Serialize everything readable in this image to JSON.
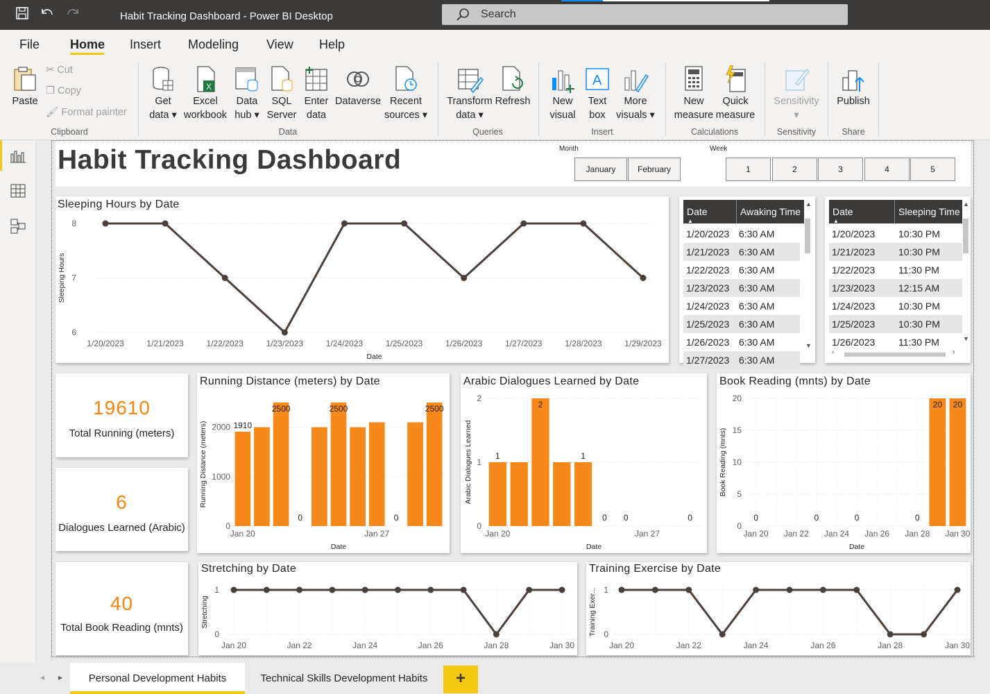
{
  "window": {
    "title": "Habit Tracking Dashboard - Power BI Desktop",
    "search_placeholder": "Search"
  },
  "menu": {
    "items": [
      "File",
      "Home",
      "Insert",
      "Modeling",
      "View",
      "Help"
    ],
    "active": "Home"
  },
  "ribbon": {
    "paste": "Paste",
    "cut": "Cut",
    "copy": "Copy",
    "format_painter": "Format painter",
    "get_data": [
      "Get",
      "data"
    ],
    "excel": [
      "Excel",
      "workbook"
    ],
    "data_hub": [
      "Data",
      "hub"
    ],
    "sql": [
      "SQL",
      "Server"
    ],
    "enter_data": [
      "Enter",
      "data"
    ],
    "dataverse": "Dataverse",
    "recent": [
      "Recent",
      "sources"
    ],
    "transform": [
      "Transform",
      "data"
    ],
    "refresh": "Refresh",
    "new_visual": [
      "New",
      "visual"
    ],
    "text_box": [
      "Text",
      "box"
    ],
    "more_visuals": [
      "More",
      "visuals"
    ],
    "new_measure": [
      "New",
      "measure"
    ],
    "quick_measure": [
      "Quick",
      "measure"
    ],
    "sensitivity": "Sensitivity",
    "publish": "Publish",
    "groups": {
      "clipboard": "Clipboard",
      "data": "Data",
      "queries": "Queries",
      "insert": "Insert",
      "calculations": "Calculations",
      "sensitivity": "Sensitivity",
      "share": "Share"
    }
  },
  "report": {
    "title": "Habit Tracking Dashboard",
    "month_slicer": {
      "label": "Month",
      "options": [
        "January",
        "February"
      ]
    },
    "week_slicer": {
      "label": "Week",
      "options": [
        "1",
        "2",
        "3",
        "4",
        "5"
      ]
    },
    "awaking_table": {
      "headers": [
        "Date",
        "Awaking Time"
      ],
      "rows": [
        [
          "1/20/2023",
          "6:30 AM"
        ],
        [
          "1/21/2023",
          "6:30 AM"
        ],
        [
          "1/22/2023",
          "6:30 AM"
        ],
        [
          "1/23/2023",
          "6:30 AM"
        ],
        [
          "1/24/2023",
          "6:30 AM"
        ],
        [
          "1/25/2023",
          "6:30 AM"
        ],
        [
          "1/26/2023",
          "6:30 AM"
        ],
        [
          "1/27/2023",
          "6:30 AM"
        ]
      ]
    },
    "sleeping_table": {
      "headers": [
        "Date",
        "Sleeping Time"
      ],
      "rows": [
        [
          "1/20/2023",
          "10:30 PM"
        ],
        [
          "1/21/2023",
          "10:30 PM"
        ],
        [
          "1/22/2023",
          "11:30 PM"
        ],
        [
          "1/23/2023",
          "12:15 AM"
        ],
        [
          "1/24/2023",
          "10:30 PM"
        ],
        [
          "1/25/2023",
          "10:30 PM"
        ],
        [
          "1/26/2023",
          "11:30 PM"
        ]
      ]
    },
    "kpis": [
      {
        "value": "19610",
        "label": "Total Running (meters)"
      },
      {
        "value": "6",
        "label": "Dialogues Learned (Arabic)"
      },
      {
        "value": "40",
        "label": "Total Book Reading (mnts)"
      }
    ]
  },
  "chart_data": [
    {
      "id": "sleep",
      "type": "line",
      "title": "Sleeping Hours by Date",
      "xlabel": "Date",
      "ylabel": "Sleeping Hours",
      "categories": [
        "1/20/2023",
        "1/21/2023",
        "1/22/2023",
        "1/23/2023",
        "1/24/2023",
        "1/25/2023",
        "1/26/2023",
        "1/27/2023",
        "1/28/2023",
        "1/29/2023"
      ],
      "values": [
        8,
        8,
        7,
        6,
        8,
        8,
        7,
        8,
        8,
        7
      ],
      "ylim": [
        6,
        8
      ],
      "yticks": [
        6,
        7,
        8
      ],
      "grid": true
    },
    {
      "id": "running",
      "type": "bar",
      "title": "Running Distance (meters) by Date",
      "xlabel": "Date",
      "ylabel": "Running Distance (meters)",
      "x": [
        "Jan 20",
        "Jan 21",
        "Jan 22",
        "Jan 23",
        "Jan 24",
        "Jan 25",
        "Jan 26",
        "Jan 27",
        "Jan 28",
        "Jan 29",
        "Jan 30"
      ],
      "values": [
        1910,
        2000,
        2500,
        0,
        2000,
        2500,
        2000,
        2100,
        0,
        2100,
        2500
      ],
      "ylim": [
        0,
        2500
      ],
      "yticks": [
        0,
        1000,
        2000
      ],
      "xticks": [
        "Jan 20",
        "Jan 27"
      ],
      "data_labels": {
        "0": "1910",
        "2": "2500",
        "3": "0",
        "5": "2500",
        "8": "0",
        "10": "2500"
      }
    },
    {
      "id": "arabic",
      "type": "bar",
      "title": "Arabic Dialogues Learned by Date",
      "xlabel": "Date",
      "ylabel": "Arabic Dialogues Learned",
      "x": [
        "Jan 20",
        "Jan 21",
        "Jan 22",
        "Jan 23",
        "Jan 24",
        "Jan 25",
        "Jan 26",
        "Jan 27",
        "Jan 28",
        "Jan 29"
      ],
      "values": [
        1,
        1,
        2,
        1,
        1,
        0,
        0,
        0,
        0,
        0
      ],
      "ylim": [
        0,
        2
      ],
      "yticks": [
        0,
        1,
        2
      ],
      "xticks": [
        "Jan 20",
        "Jan 27"
      ],
      "data_labels": {
        "0": "1",
        "2": "2",
        "4": "1",
        "5": "0",
        "6": "0",
        "9": "0"
      }
    },
    {
      "id": "book",
      "type": "bar",
      "title": "Book Reading (mnts) by Date",
      "xlabel": "Date",
      "ylabel": "Book Reading (mnts)",
      "x": [
        "Jan 20",
        "Jan 21",
        "Jan 22",
        "Jan 23",
        "Jan 24",
        "Jan 25",
        "Jan 26",
        "Jan 27",
        "Jan 28",
        "Jan 29",
        "Jan 30"
      ],
      "values": [
        0,
        0,
        0,
        0,
        0,
        0,
        0,
        0,
        0,
        20,
        20
      ],
      "ylim": [
        0,
        20
      ],
      "yticks": [
        0,
        5,
        10,
        15,
        20
      ],
      "xticks": [
        "Jan 20",
        "Jan 22",
        "Jan 24",
        "Jan 26",
        "Jan 28",
        "Jan 30"
      ],
      "data_labels": {
        "0": "0",
        "3": "0",
        "5": "0",
        "8": "0",
        "9": "20",
        "10": "20"
      }
    },
    {
      "id": "stretch",
      "type": "line",
      "title": "Stretching by Date",
      "xlabel": "",
      "ylabel": "Stretching",
      "x": [
        "Jan 20",
        "Jan 21",
        "Jan 22",
        "Jan 23",
        "Jan 24",
        "Jan 25",
        "Jan 26",
        "Jan 27",
        "Jan 28",
        "Jan 29",
        "Jan 30"
      ],
      "values": [
        1,
        1,
        1,
        1,
        1,
        1,
        1,
        1,
        0,
        1,
        1
      ],
      "ylim": [
        0,
        1
      ],
      "yticks": [
        0,
        1
      ],
      "xticks": [
        "Jan 20",
        "Jan 22",
        "Jan 24",
        "Jan 26",
        "Jan 28",
        "Jan 30"
      ]
    },
    {
      "id": "training",
      "type": "line",
      "title": "Training Exercise by Date",
      "xlabel": "",
      "ylabel": "Training Exer...",
      "x": [
        "Jan 20",
        "Jan 21",
        "Jan 22",
        "Jan 23",
        "Jan 24",
        "Jan 25",
        "Jan 26",
        "Jan 27",
        "Jan 28",
        "Jan 29",
        "Jan 30"
      ],
      "values": [
        1,
        1,
        1,
        0,
        1,
        1,
        1,
        1,
        0,
        0,
        1
      ],
      "ylim": [
        0,
        1
      ],
      "yticks": [
        0,
        1
      ],
      "xticks": [
        "Jan 20",
        "Jan 22",
        "Jan 24",
        "Jan 26",
        "Jan 28",
        "Jan 30"
      ]
    }
  ],
  "colors": {
    "line": "#4b3f38",
    "bar": "#f7881c",
    "kpi": "#f2860f",
    "header": "#3b3a39",
    "accent": "#f2c811"
  },
  "tabs": {
    "items": [
      "Personal Development Habits",
      "Technical Skills Development Habits"
    ],
    "active": 0,
    "add": "+"
  }
}
